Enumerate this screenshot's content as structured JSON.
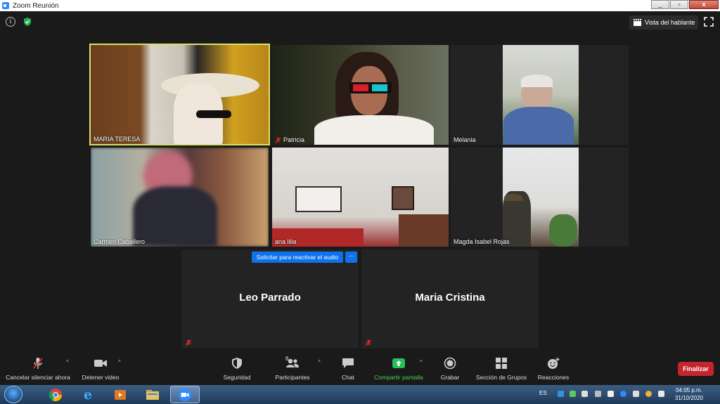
{
  "window": {
    "title": "Zoom Reunión",
    "minimize": "_",
    "maximize": "▫",
    "close": "x"
  },
  "top": {
    "speaker_view_label": "Vista del hablante"
  },
  "participants": [
    {
      "name": "MARIA TERESA"
    },
    {
      "name": "Patricia"
    },
    {
      "name": "Melania"
    },
    {
      "name": "Carmen Caballero"
    },
    {
      "name": "ana lilia"
    },
    {
      "name": "Magda Isabel Rojas"
    },
    {
      "name": "Leo Parrado"
    },
    {
      "name": "Maria Cristina"
    }
  ],
  "request_unmute_label": "Solicitar para reactivar el audio",
  "more_label": "···",
  "toolbar": {
    "mute_label": "Cancelar silenciar ahora",
    "video_label": "Detener video",
    "security_label": "Seguridad",
    "participants_label": "Participantes",
    "participants_count": "8",
    "chat_label": "Chat",
    "share_label": "Compartir pantalla",
    "record_label": "Grabar",
    "breakout_label": "Sección de Grupos",
    "reactions_label": "Reacciones",
    "end_label": "Finalizar",
    "caret": "^"
  },
  "taskbar": {
    "language": "ES",
    "time": "04:05 p.m.",
    "date": "31/10/2020"
  },
  "colors": {
    "active_speaker_border": "#d7e06a",
    "accent_blue": "#0e72ed",
    "end_red": "#c4262d",
    "share_green": "#4ad04a"
  }
}
